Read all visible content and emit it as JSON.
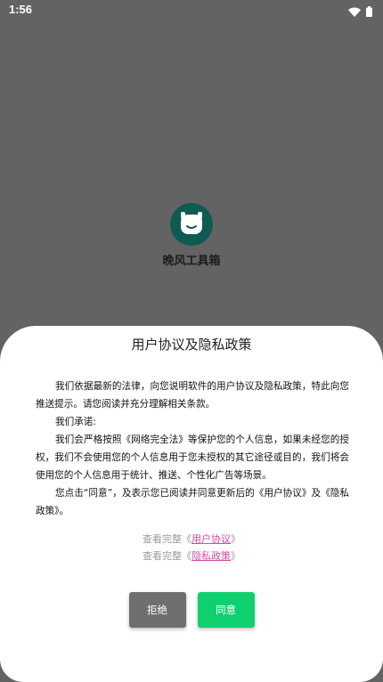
{
  "status_bar": {
    "time": "1:56",
    "icons": [
      "wifi-icon",
      "battery-icon"
    ]
  },
  "splash": {
    "app_icon": "robot-face-icon",
    "app_name": "晚风工具箱",
    "icon_color": "#0f5a52"
  },
  "dialog": {
    "title": "用户协议及隐私政策",
    "paragraphs": [
      "我们依据最新的法律，向您说明软件的用户协议及隐私政策，特此向您推送提示。请您阅读并充分理解相关条款。",
      "我们承诺:",
      "我们会严格按照《网络完全法》等保护您的个人信息，如果未经您的授权，我们不会使用您的个人信息用于您未授权的其它途径或目的，我们将会使用您的个人信息用于统计、推送、个性化广告等场景。",
      "您点击“同意”，及表示您已阅读并同意更新后的《用户协议》及《隐私政策》。"
    ],
    "links": [
      {
        "prefix": "查看完整《",
        "link_text": "用户协议",
        "suffix": "》"
      },
      {
        "prefix": "查看完整《",
        "link_text": "隐私政策",
        "suffix": "》"
      }
    ],
    "buttons": {
      "reject_label": "拒绝",
      "agree_label": "同意"
    }
  },
  "colors": {
    "background": "#636363",
    "agree_button": "#0fd06f",
    "reject_button": "#6f6f6f",
    "link": "#d64aa0"
  }
}
